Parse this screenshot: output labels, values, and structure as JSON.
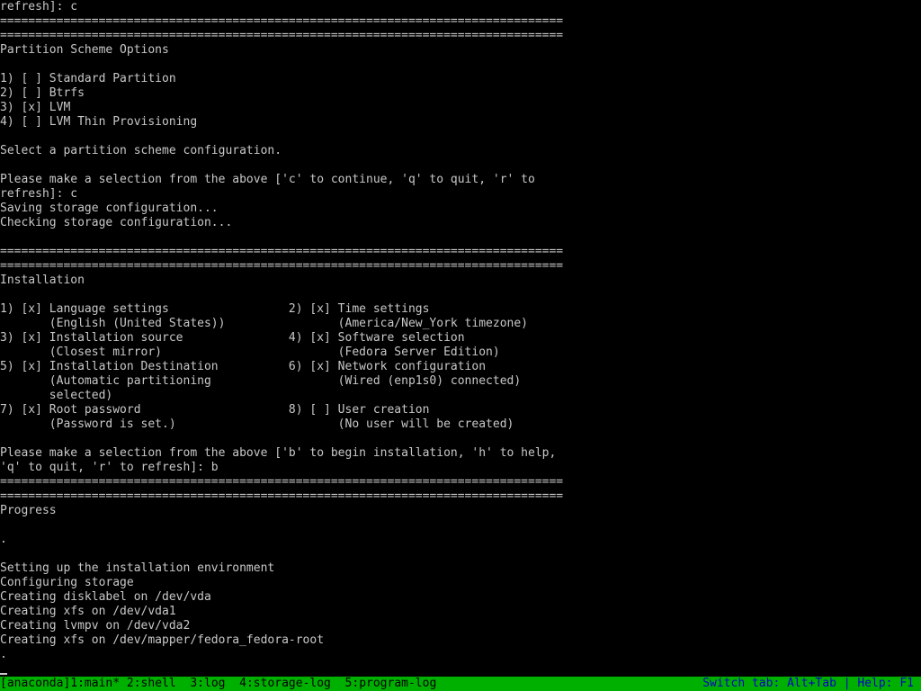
{
  "terminal": {
    "lines": [
      "refresh]: c",
      "================================================================================",
      "================================================================================",
      "Partition Scheme Options",
      "",
      "1) [ ] Standard Partition",
      "2) [ ] Btrfs",
      "3) [x] LVM",
      "4) [ ] LVM Thin Provisioning",
      "",
      "Select a partition scheme configuration.",
      "",
      "Please make a selection from the above ['c' to continue, 'q' to quit, 'r' to",
      "refresh]: c",
      "Saving storage configuration...",
      "Checking storage configuration...",
      "",
      "================================================================================",
      "================================================================================",
      "Installation",
      "",
      "1) [x] Language settings                 2) [x] Time settings",
      "       (English (United States))                (America/New_York timezone)",
      "3) [x] Installation source               4) [x] Software selection",
      "       (Closest mirror)                         (Fedora Server Edition)",
      "5) [x] Installation Destination          6) [x] Network configuration",
      "       (Automatic partitioning                  (Wired (enp1s0) connected)",
      "       selected)",
      "7) [x] Root password                     8) [ ] User creation",
      "       (Password is set.)                       (No user will be created)",
      "",
      "Please make a selection from the above ['b' to begin installation, 'h' to help,",
      "'q' to quit, 'r' to refresh]: b",
      "================================================================================",
      "================================================================================",
      "Progress",
      "",
      ".",
      "",
      "Setting up the installation environment",
      "Configuring storage",
      "Creating disklabel on /dev/vda",
      "Creating xfs on /dev/vda1",
      "Creating lvmpv on /dev/vda2",
      "Creating xfs on /dev/mapper/fedora_fedora-root",
      "."
    ]
  },
  "status_bar": {
    "windows": [
      {
        "label": "[anaconda]1:main*"
      },
      {
        "label": " 2:shell "
      },
      {
        "label": " 3:log "
      },
      {
        "label": " 4:storage-log "
      },
      {
        "label": " 5:program-log"
      }
    ],
    "help_text": "Switch tab: Alt+Tab | Help: F1",
    "colors": {
      "background": "#00b000",
      "window_text": "#000000",
      "help_text": "#0000c8"
    }
  }
}
